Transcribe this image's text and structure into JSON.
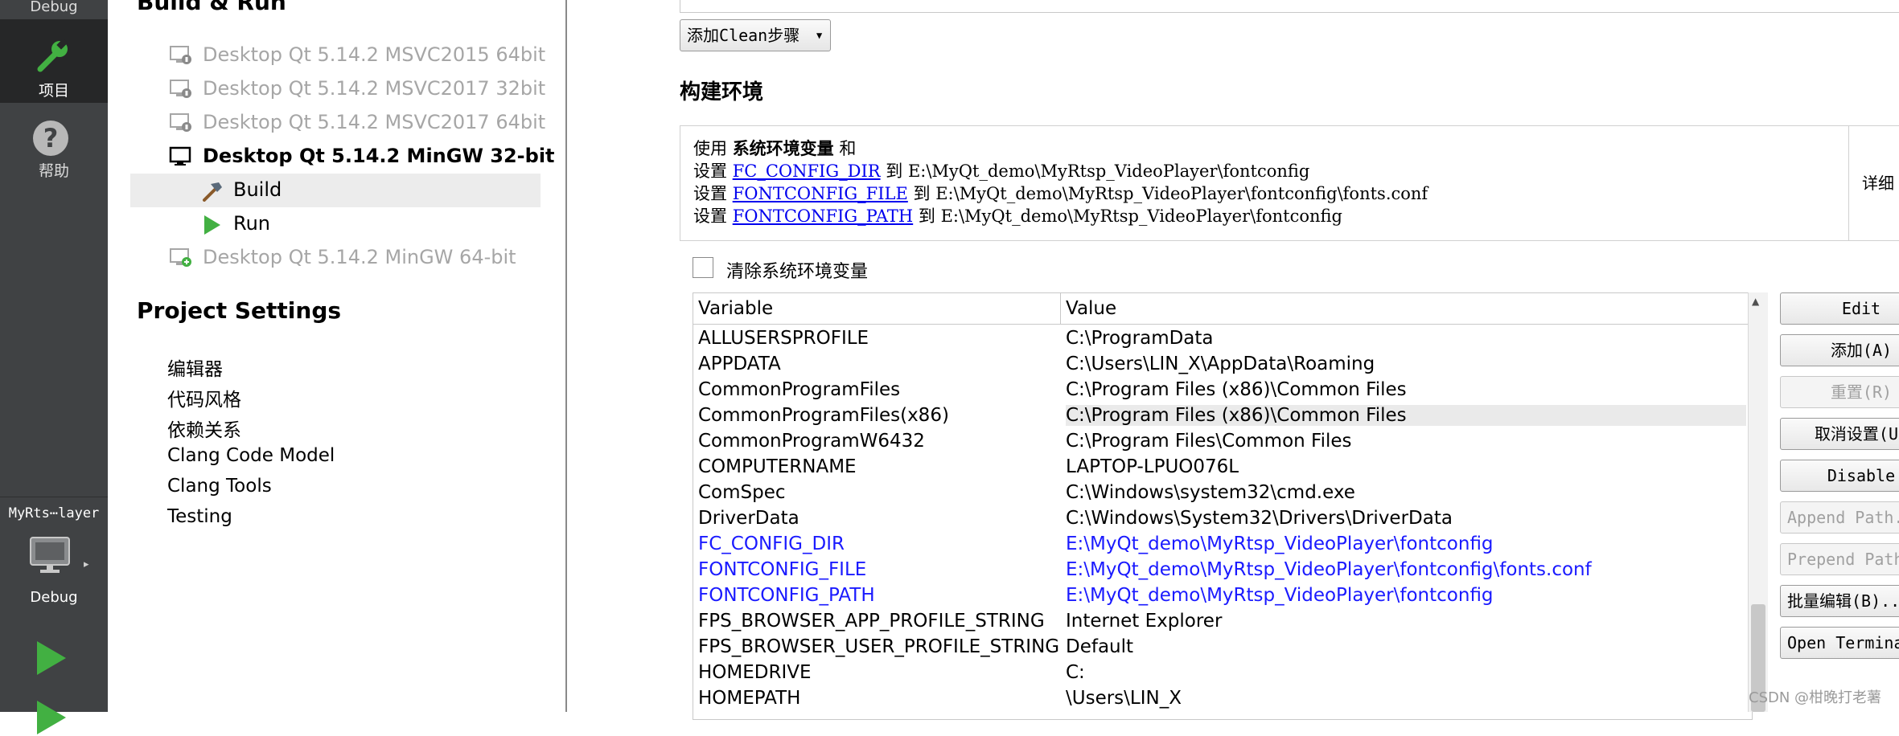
{
  "modebar": {
    "debug_top": "Debug",
    "projects": "项目",
    "help": "帮助",
    "kit_project": "MyRts⋯layer",
    "kit_config": "Debug"
  },
  "tree": {
    "build_run_header": "Build & Run",
    "kits": [
      {
        "label": "Desktop Qt 5.14.2 MSVC2015 64bit"
      },
      {
        "label": "Desktop Qt 5.14.2 MSVC2017 32bit"
      },
      {
        "label": "Desktop Qt 5.14.2 MSVC2017 64bit"
      },
      {
        "label": "Desktop Qt 5.14.2 MinGW 32-bit"
      },
      {
        "label": "Desktop Qt 5.14.2 MinGW 64-bit"
      }
    ],
    "build": "Build",
    "run": "Run",
    "project_settings_header": "Project Settings",
    "settings": [
      "编辑器",
      "代码风格",
      "依赖关系",
      "Clang Code Model",
      "Clang Tools",
      "Testing"
    ]
  },
  "main": {
    "add_clean_step": "添加Clean步骤",
    "env_heading": "构建环境",
    "summary": {
      "line1_prefix": "使用",
      "line1_bold": "系统环境变量",
      "line1_suffix": "和",
      "set": "设置",
      "to": "到",
      "entries": [
        {
          "name": "FC_CONFIG_DIR",
          "value": "E:\\MyQt_demo\\MyRtsp_VideoPlayer\\fontconfig"
        },
        {
          "name": "FONTCONFIG_FILE",
          "value": "E:\\MyQt_demo\\MyRtsp_VideoPlayer\\fontconfig\\fonts.conf"
        },
        {
          "name": "FONTCONFIG_PATH",
          "value": "E:\\MyQt_demo\\MyRtsp_VideoPlayer\\fontconfig"
        }
      ],
      "details": "详细"
    },
    "clear_env": "清除系统环境变量",
    "table": {
      "headers": [
        "Variable",
        "Value"
      ],
      "rows": [
        {
          "var": "ALLUSERSPROFILE",
          "val": "C:\\ProgramData"
        },
        {
          "var": "APPDATA",
          "val": "C:\\Users\\LIN_X\\AppData\\Roaming"
        },
        {
          "var": "CommonProgramFiles",
          "val": "C:\\Program Files (x86)\\Common Files"
        },
        {
          "var": "CommonProgramFiles(x86)",
          "val": "C:\\Program Files (x86)\\Common Files"
        },
        {
          "var": "CommonProgramW6432",
          "val": "C:\\Program Files\\Common Files"
        },
        {
          "var": "COMPUTERNAME",
          "val": "LAPTOP-LPUO076L"
        },
        {
          "var": "ComSpec",
          "val": "C:\\Windows\\system32\\cmd.exe"
        },
        {
          "var": "DriverData",
          "val": "C:\\Windows\\System32\\Drivers\\DriverData"
        },
        {
          "var": "FC_CONFIG_DIR",
          "val": "E:\\MyQt_demo\\MyRtsp_VideoPlayer\\fontconfig"
        },
        {
          "var": "FONTCONFIG_FILE",
          "val": "E:\\MyQt_demo\\MyRtsp_VideoPlayer\\fontconfig\\fonts.conf"
        },
        {
          "var": "FONTCONFIG_PATH",
          "val": "E:\\MyQt_demo\\MyRtsp_VideoPlayer\\fontconfig"
        },
        {
          "var": "FPS_BROWSER_APP_PROFILE_STRING",
          "val": "Internet Explorer"
        },
        {
          "var": "FPS_BROWSER_USER_PROFILE_STRING",
          "val": "Default"
        },
        {
          "var": "HOMEDRIVE",
          "val": "C:"
        },
        {
          "var": "HOMEPATH",
          "val": "\\Users\\LIN_X"
        }
      ]
    },
    "actions": {
      "edit": "Edit",
      "add": "添加(A)",
      "reset": "重置(R)",
      "unset": "取消设置(U)",
      "disable": "Disable",
      "append_path": "Append Path...",
      "prepend_path": "Prepend Path...",
      "batch_edit": "批量编辑(B)...",
      "open_terminal": "Open Terminal"
    }
  },
  "watermark": "CSDN @柑晚打老薯",
  "colors": {
    "modebar_bg": "#404244",
    "modebar_active": "#262728",
    "modified_var": "#1a1aff",
    "link": "#0000ee",
    "run_green": "#42b042"
  }
}
